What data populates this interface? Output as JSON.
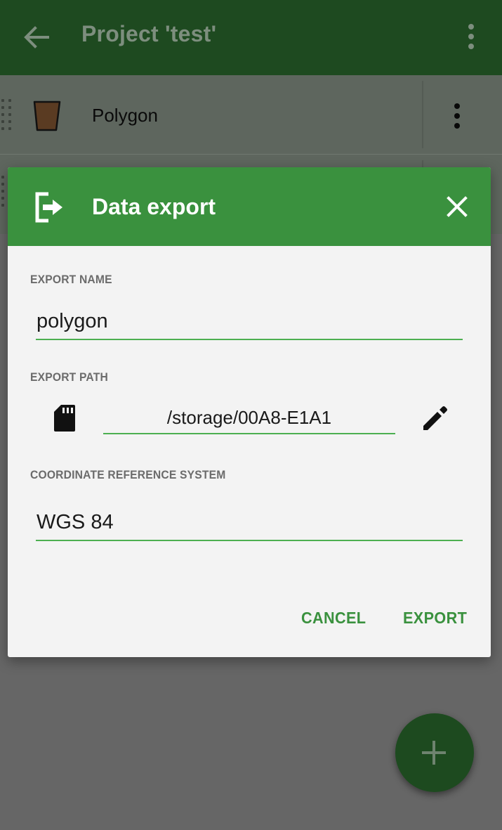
{
  "app_bar": {
    "title": "Project 'test'",
    "back_icon": "arrow-back-icon",
    "menu_icon": "more-vert-icon"
  },
  "layers": [
    {
      "name": "Polygon",
      "icon": "polygon-icon",
      "fill_color": "#5a3b22"
    }
  ],
  "dialog": {
    "title": "Data export",
    "header_icon": "export-icon",
    "close_icon": "close-icon",
    "export_name": {
      "label": "EXPORT NAME",
      "value": "polygon"
    },
    "export_path": {
      "label": "EXPORT PATH",
      "value": "/storage/00A8-E1A1",
      "storage_icon": "sd-card-icon",
      "edit_icon": "pencil-icon"
    },
    "crs": {
      "label": "COORDINATE REFERENCE SYSTEM",
      "value": "WGS 84"
    },
    "cancel_label": "CANCEL",
    "export_label": "EXPORT"
  },
  "fab": {
    "icon": "plus-icon"
  },
  "colors": {
    "accent": "#3a913e",
    "app_bar": "#1e4a20",
    "scrim": "#666666"
  }
}
